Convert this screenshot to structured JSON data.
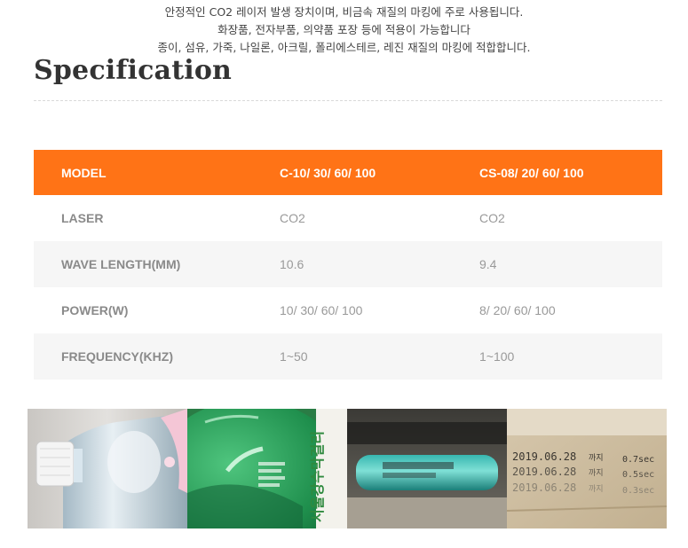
{
  "intro": {
    "lines": [
      "안정적인 CO2 레이저 발생 장치이며, 비금속 재질의 마킹에 주로 사용됩니다.",
      "화장품, 전자부품, 의약품 포장 등에 적용이 가능합니다",
      "종이, 섬유, 가죽, 나일론, 아크릴, 폴리에스테르, 레진 재질의 마킹에 적합합니다."
    ]
  },
  "section": {
    "title": "Specification"
  },
  "table": {
    "header": [
      "MODEL",
      "C-10/ 30/ 60/ 100",
      "CS-08/ 20/ 60/ 100"
    ],
    "rows": [
      [
        "LASER",
        "CO2",
        "CO2"
      ],
      [
        "WAVE LENGTH(MM)",
        "10.6",
        "9.4"
      ],
      [
        "POWER(W)",
        "10/ 30/ 60/ 100",
        "8/ 20/ 60/ 100"
      ],
      [
        "FREQUENCY(KHZ)",
        "1~50",
        "1~100"
      ]
    ]
  },
  "gallery": {
    "green_bottle_label": "서울강수막걸리",
    "carton_lines": [
      {
        "date": "2019.06.28",
        "word": "까지",
        "speed": "0.7sec"
      },
      {
        "date": "2019.06.28",
        "word": "까지",
        "speed": "0.5sec"
      },
      {
        "date": "2019.06.28",
        "word": "까지",
        "speed": "0.3sec"
      }
    ]
  },
  "colors": {
    "accent": "#ff7316",
    "alt_row": "#f6f6f6"
  }
}
